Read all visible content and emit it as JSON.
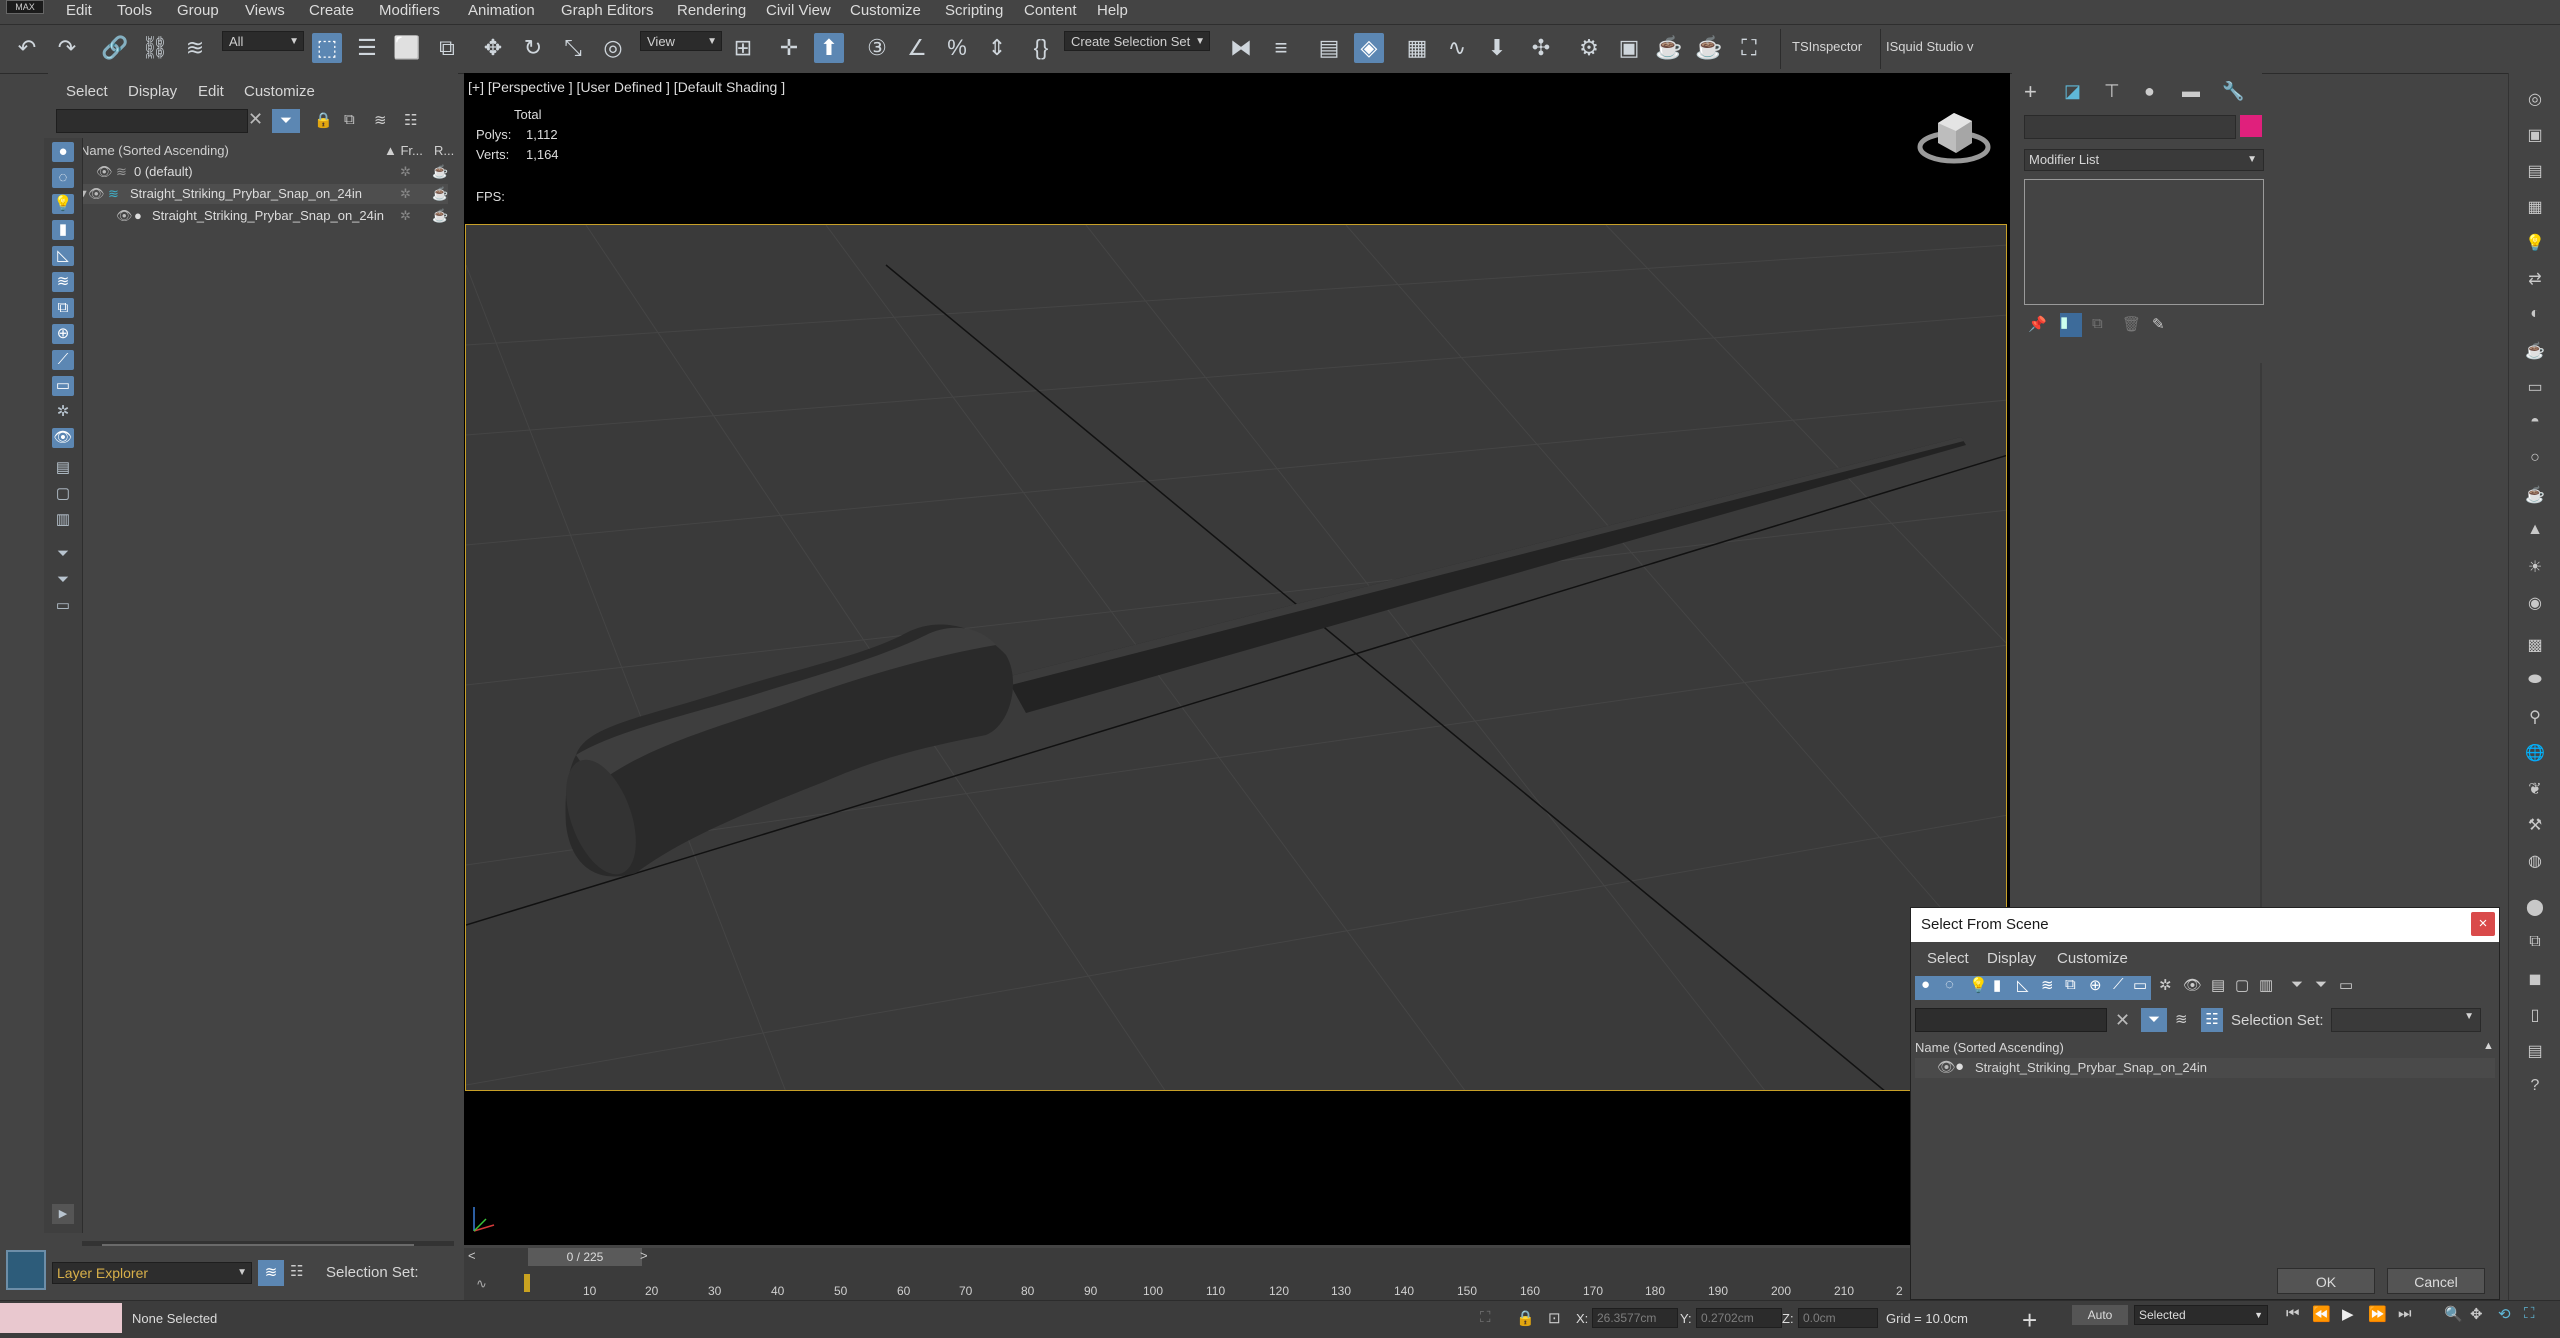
{
  "app": {
    "logo_text": "MAX"
  },
  "menu": [
    "Edit",
    "Tools",
    "Group",
    "Views",
    "Create",
    "Modifiers",
    "Animation",
    "Graph Editors",
    "Rendering",
    "Civil View",
    "Customize",
    "Scripting",
    "Content",
    "Help"
  ],
  "toolbar": {
    "selection_filter": "All",
    "ref_coord": "View",
    "named_selection": "Create Selection Set",
    "tsinspector": "TSInspector",
    "isquid": "ISquid Studio v"
  },
  "scene_explorer": {
    "menu": [
      "Select",
      "Display",
      "Edit",
      "Customize"
    ],
    "column_name": "Name (Sorted Ascending)",
    "column_fr": "▲ Fr...",
    "column_r": "R...",
    "rows": [
      {
        "label": "0 (default)"
      },
      {
        "label": "Straight_Striking_Prybar_Snap_on_24in"
      },
      {
        "label": "Straight_Striking_Prybar_Snap_on_24in"
      }
    ],
    "footer_label": "Layer Explorer",
    "selection_set_label": "Selection Set:"
  },
  "viewport": {
    "label": "[+] [Perspective ] [User Defined ] [Default Shading ]",
    "stats": {
      "total_label": "Total",
      "polys_label": "Polys:",
      "polys_value": "1,112",
      "verts_label": "Verts:",
      "verts_value": "1,164",
      "fps_label": "FPS:"
    }
  },
  "command_panel": {
    "modifier_list": "Modifier List"
  },
  "dialog": {
    "title": "Select From Scene",
    "close": "×",
    "menu": [
      "Select",
      "Display",
      "Customize"
    ],
    "selection_set_label": "Selection Set:",
    "column_name": "Name (Sorted Ascending)",
    "rows": [
      {
        "label": "Straight_Striking_Prybar_Snap_on_24in"
      }
    ],
    "ok": "OK",
    "cancel": "Cancel"
  },
  "timeline": {
    "slider_value": "0 / 225",
    "prev": "<",
    "next": ">",
    "ticks": [
      "10",
      "20",
      "30",
      "40",
      "50",
      "60",
      "70",
      "80",
      "90",
      "100",
      "110",
      "120",
      "130",
      "140",
      "150",
      "160",
      "170",
      "180",
      "190",
      "200",
      "210",
      "2"
    ]
  },
  "status": {
    "selection": "None Selected",
    "x_label": "X:",
    "x_value": "26.3577cm",
    "y_label": "Y:",
    "y_value": "0.2702cm",
    "z_label": "Z:",
    "z_value": "0.0cm",
    "grid": "Grid = 10.0cm",
    "auto": "Auto",
    "selected": "Selected"
  },
  "colors": {
    "accent": "#5c87b3",
    "viewport_border": "#c8a028",
    "swatch": "#e0207c"
  }
}
